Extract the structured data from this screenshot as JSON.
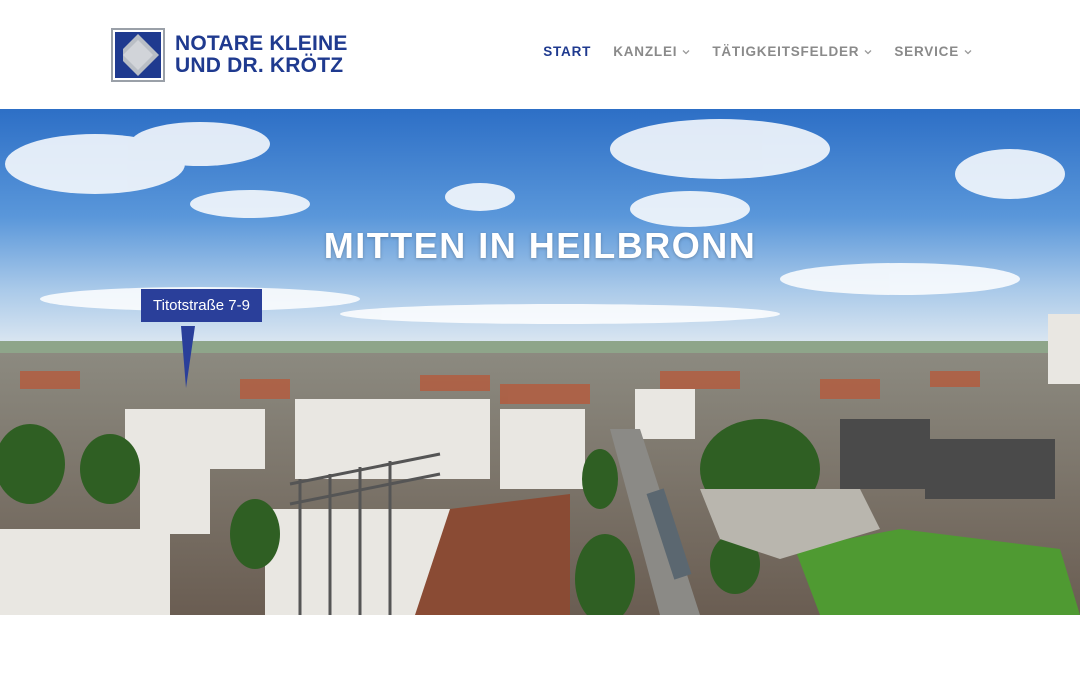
{
  "brand": {
    "line1": "NOTARE KLEINE",
    "line2": "UND DR. KRÖTZ",
    "color": "#1f3a8f"
  },
  "nav": {
    "items": [
      {
        "label": "START",
        "active": true,
        "has_dropdown": false
      },
      {
        "label": "KANZLEI",
        "active": false,
        "has_dropdown": true
      },
      {
        "label": "TÄTIGKEITSFELDER",
        "active": false,
        "has_dropdown": true
      },
      {
        "label": "SERVICE",
        "active": false,
        "has_dropdown": true
      }
    ],
    "active_color": "#1f3a8f",
    "inactive_color": "#8a8a8a"
  },
  "hero": {
    "title": "MITTEN IN HEILBRONN",
    "location_label": "Titotstraße 7-9",
    "label_color": "#2a3f9a"
  }
}
